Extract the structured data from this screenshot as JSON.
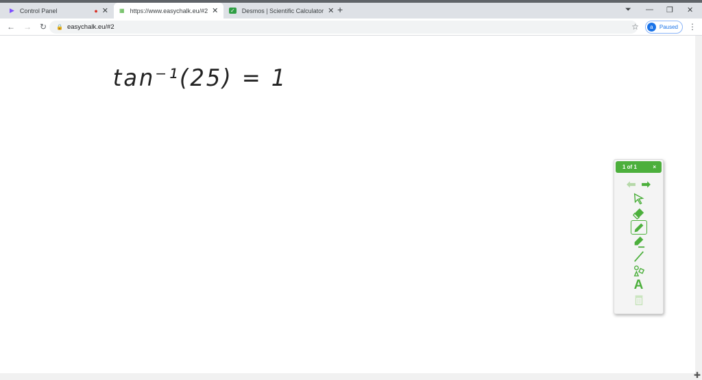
{
  "browser": {
    "tabs": [
      {
        "label": "Control Panel",
        "icon": "play-logo-icon",
        "recording": true
      },
      {
        "label": "https://www.easychalk.eu/#2",
        "icon": "easychalk-icon",
        "active": true
      },
      {
        "label": "Desmos | Scientific Calculator",
        "icon": "desmos-icon"
      }
    ],
    "url": "easychalk.eu/#2",
    "profile_initial": "a",
    "profile_status": "Paused"
  },
  "canvas": {
    "handwriting": "tan⁻¹(25) = 1"
  },
  "panel": {
    "page_indicator": "1 of 1",
    "close": "×",
    "tools": [
      "back-arrow",
      "forward-arrow",
      "select",
      "eraser",
      "pen",
      "highlighter",
      "line",
      "shapes",
      "text",
      "trash"
    ],
    "accent": "#4caf3c"
  }
}
